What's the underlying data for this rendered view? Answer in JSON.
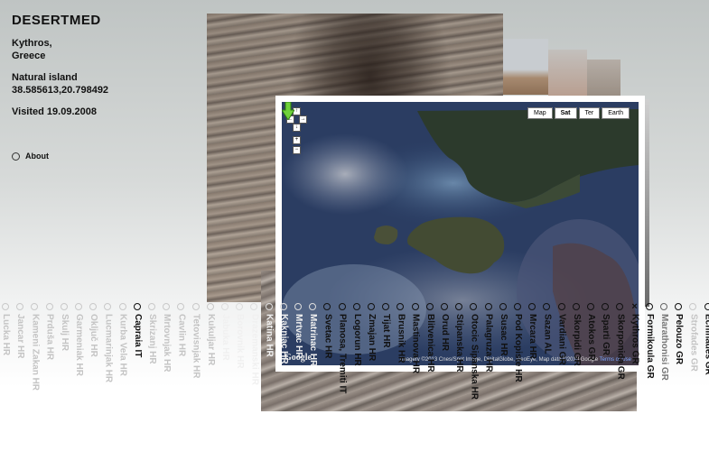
{
  "site": {
    "title": "DESERTMED"
  },
  "place": {
    "name": "Kythros,",
    "country": "Greece",
    "type": "Natural island",
    "coordinates": "38.585613,20.798492",
    "visited": "Visited 19.09.2008"
  },
  "nav": {
    "about_label": "About"
  },
  "map": {
    "types": [
      "Map",
      "Sat",
      "Ter",
      "Earth"
    ],
    "active_type": "Sat",
    "attribution": "Imagery ©2013 Cnes/Spot Image, DigitalGlobe, GeoEye, Map data ©2013 Google",
    "terms_label": "Terms of Use",
    "logo": "Google",
    "controls": {
      "up": "↑",
      "left": "←",
      "right": "→",
      "down": "↓",
      "zoom_in": "+",
      "zoom_out": "−"
    },
    "marker_color": "#6fd13b"
  },
  "locations": [
    {
      "name": "Lucka HR",
      "style": "faded"
    },
    {
      "name": "Jancar HR",
      "style": "faded"
    },
    {
      "name": "Kameni Zakan HR",
      "style": "faded"
    },
    {
      "name": "Prduša HR",
      "style": "faded"
    },
    {
      "name": "Skulj HR",
      "style": "faded"
    },
    {
      "name": "Garmeniak HR",
      "style": "faded"
    },
    {
      "name": "Oključ HR",
      "style": "faded"
    },
    {
      "name": "Lucmarinjak HR",
      "style": "faded"
    },
    {
      "name": "Kurba Vela HR",
      "style": "faded"
    },
    {
      "name": "Capraia IT",
      "style": "dark"
    },
    {
      "name": "Skrizanj HR",
      "style": "faded"
    },
    {
      "name": "Mrtovnjak HR",
      "style": "faded"
    },
    {
      "name": "Cavlin HR",
      "style": "faded"
    },
    {
      "name": "Tetovisnjak HR",
      "style": "faded"
    },
    {
      "name": "Kukuljar HR",
      "style": "faded"
    },
    {
      "name": "Jabuka HR",
      "style": "mid"
    },
    {
      "name": "Borovnik HR",
      "style": "mid"
    },
    {
      "name": "Drazemanski HR",
      "style": "mid"
    },
    {
      "name": "Katina HR",
      "style": "mid"
    },
    {
      "name": "Kaknjac HR",
      "style": "mid"
    },
    {
      "name": "Mrtvac HR",
      "style": "mid"
    },
    {
      "name": "Matrinac HR",
      "style": "mid"
    },
    {
      "name": "Svetac HR",
      "style": "dark"
    },
    {
      "name": "Planosa, Tremiti IT",
      "style": "dark"
    },
    {
      "name": "Logorun HR",
      "style": "dark"
    },
    {
      "name": "Zmajan HR",
      "style": "dark"
    },
    {
      "name": "Tijat HR",
      "style": "dark"
    },
    {
      "name": "Brusnik HR",
      "style": "dark"
    },
    {
      "name": "Mastinova HR",
      "style": "dark"
    },
    {
      "name": "Blitvenica HR",
      "style": "dark"
    },
    {
      "name": "Orud HR",
      "style": "dark"
    },
    {
      "name": "Stipanska HR",
      "style": "dark"
    },
    {
      "name": "Otocic Sipanska HR",
      "style": "dark"
    },
    {
      "name": "Palagruza HR",
      "style": "dark"
    },
    {
      "name": "Susac HR",
      "style": "dark"
    },
    {
      "name": "Pod Kopiste HR",
      "style": "dark"
    },
    {
      "name": "Mrcara HR",
      "style": "dark"
    },
    {
      "name": "Sazan AL",
      "style": "dark"
    },
    {
      "name": "Vardiani GR",
      "style": "dark"
    },
    {
      "name": "Skorpidi GR",
      "style": "dark"
    },
    {
      "name": "Atokos GR",
      "style": "dark"
    },
    {
      "name": "Sparti GR",
      "style": "dark"
    },
    {
      "name": "Skorponida GR",
      "style": "dark"
    },
    {
      "name": "Kythros GR",
      "style": "dark",
      "current": true
    },
    {
      "name": "Formikoula GR",
      "style": "dark"
    },
    {
      "name": "Marathonisi GR",
      "style": "grey"
    },
    {
      "name": "Pelouzo GR",
      "style": "dark"
    },
    {
      "name": "Strofades GR",
      "style": "faded"
    },
    {
      "name": "Echinades GR",
      "style": "dark"
    }
  ]
}
